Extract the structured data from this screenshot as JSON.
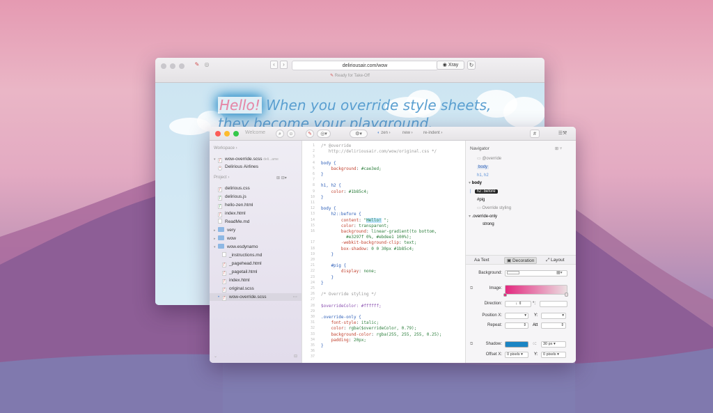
{
  "back_window": {
    "url": "deliriousair.com/wow",
    "xray_label": "Xray",
    "status": "Ready for Take-Off",
    "headline_hello": "Hello!",
    "headline_rest": "When you override style sheets,",
    "headline_line2": "they become your playground."
  },
  "front_window": {
    "title": "Welcome",
    "crumbs": [
      "zen",
      "new",
      "re-indent"
    ],
    "hash": "#",
    "sidebar": {
      "workspace_label": "Workspace",
      "workspace_items": [
        {
          "label": "wow-override.scss",
          "meta": "deli...ame",
          "type": "file"
        },
        {
          "label": "Delirious Airlines",
          "type": "site"
        }
      ],
      "project_label": "Project",
      "project_items": [
        {
          "label": "delirious.css",
          "type": "file",
          "indent": 0
        },
        {
          "label": "delirious.js",
          "type": "file",
          "indent": 0
        },
        {
          "label": "hello-zen.html",
          "type": "file",
          "indent": 0
        },
        {
          "label": "index.html",
          "type": "file",
          "indent": 0
        },
        {
          "label": "ReadMe.md",
          "type": "doc",
          "indent": 0
        },
        {
          "label": "very",
          "type": "folder",
          "indent": 0
        },
        {
          "label": "wow",
          "type": "folder",
          "indent": 0
        },
        {
          "label": "wow.esdynamo",
          "type": "folder-open",
          "indent": 0
        },
        {
          "label": "_instructions.md",
          "type": "doc",
          "indent": 1
        },
        {
          "label": "_pagehead.html",
          "type": "file",
          "indent": 1
        },
        {
          "label": "_pagetail.html",
          "type": "file",
          "indent": 1
        },
        {
          "label": "index.html",
          "type": "file",
          "indent": 1
        },
        {
          "label": "original.scss",
          "type": "file",
          "indent": 1
        },
        {
          "label": "wow-override.scss",
          "type": "file",
          "indent": 1,
          "selected": true
        }
      ]
    },
    "code_lines": [
      "/* @override",
      "   http://deliriousair.com/wow/original.css */",
      "",
      "body {",
      "    background: #cae3ed;",
      "}",
      "",
      "h1, h2 {",
      "    color: #1b85c4;",
      "}",
      "",
      "body {",
      "    h2::before {",
      "        content: \"Hello! \";",
      "        color: transparent;",
      "        background: linear-gradient(to bottom,",
      "          #e3297f 0%, #ebdee1 100%);",
      "        -webkit-background-clip: text;",
      "        box-shadow: 0 0 30px #1b85c4;",
      "    }",
      "",
      "    #pig {",
      "        display: none;",
      "    }",
      "}",
      "",
      "/* Override styling */",
      "",
      "$overrideColor: #ffffff;",
      "",
      ".override-only {",
      "    font-style: italic;",
      "    color: rgba($overrideColor, 0.79);",
      "    background-color: rgba(255, 255, 255, 0.25);",
      "    padding: 20px;",
      "}",
      "",
      ""
    ],
    "line_numbers": [
      "1",
      "2",
      "3",
      "4",
      "5",
      "6",
      "7",
      "8",
      "9",
      "10",
      "11",
      "12",
      "13",
      "14",
      "15",
      "16",
      "",
      "17",
      "18",
      "19",
      "20",
      "21",
      "22",
      "23",
      "24",
      "25",
      "26",
      "27",
      "28",
      "29",
      "30",
      "31",
      "32",
      "33",
      "34",
      "35",
      "36",
      "37"
    ],
    "navigator": {
      "title": "Navigator",
      "items": [
        {
          "label": "@override",
          "kind": "comment",
          "indent": 1
        },
        {
          "label": "body",
          "kind": "chip",
          "indent": 1
        },
        {
          "label": "h1, h2",
          "kind": "sel",
          "indent": 1
        },
        {
          "label": "body",
          "kind": "bold",
          "indent": 0
        },
        {
          "label": "h2::before",
          "kind": "dark",
          "indent": 1
        },
        {
          "label": "#pig",
          "kind": "plain",
          "indent": 1
        },
        {
          "label": "Override styling",
          "kind": "comment",
          "indent": 1
        },
        {
          "label": ".override-only",
          "kind": "plain",
          "indent": 0
        },
        {
          "label": "strong",
          "kind": "plain",
          "indent": 2
        }
      ]
    },
    "inspector": {
      "tabs": [
        "Text",
        "Decoration",
        "Layout"
      ],
      "active_tab": "Decoration",
      "background_label": "Background:",
      "image_label": "Image:",
      "direction_label": "Direction:",
      "direction_value": "↓",
      "degree": "°:",
      "position_x_label": "Position X:",
      "y_label": "Y:",
      "repeat_label": "Repeat:",
      "att_label": "Att",
      "shadow_label": "Shadow:",
      "shadow_size": "30 px",
      "offset_x_label": "Offset X:",
      "offset_x_value": "0 pixels",
      "offset_y_value": "0 pixels",
      "accent": "#1b85c4",
      "gradient_start": "#e3297f",
      "gradient_end": "#ebdee1"
    }
  }
}
